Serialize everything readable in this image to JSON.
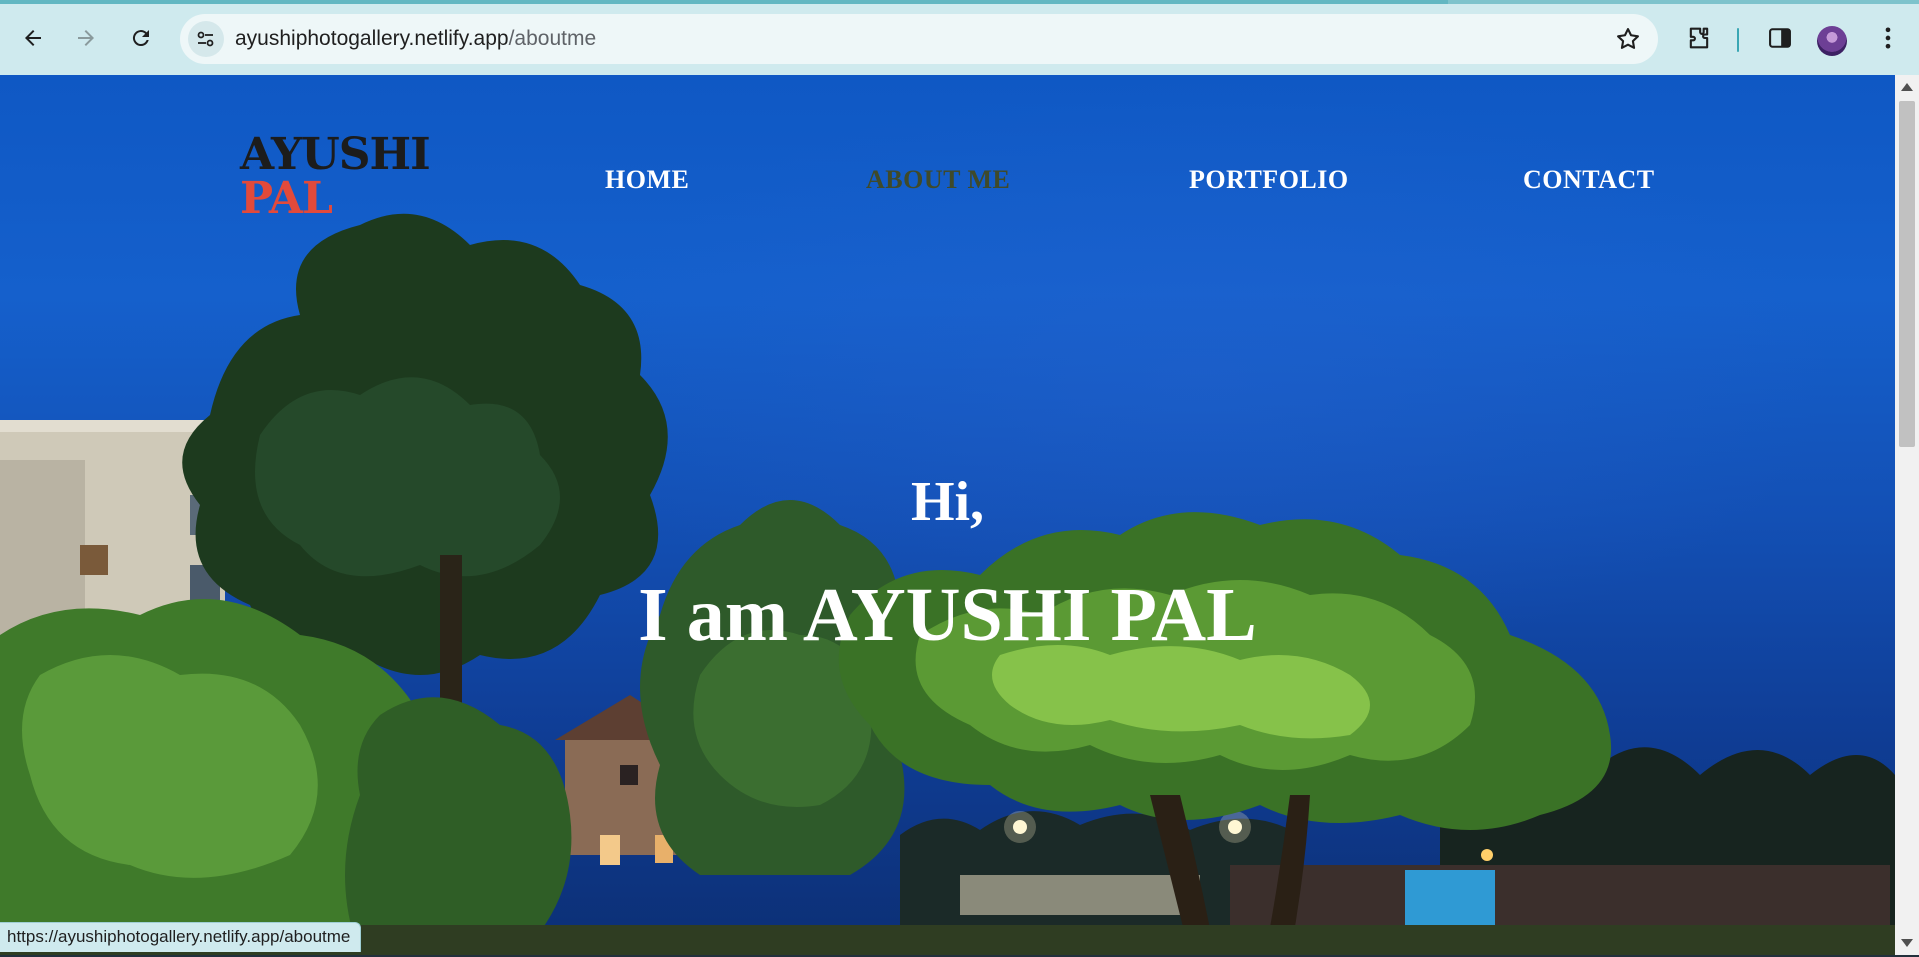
{
  "browser": {
    "url_host": "ayushiphotogallery.netlify.app",
    "url_path": "/aboutme",
    "status_url": "https://ayushiphotogallery.netlify.app/aboutme"
  },
  "site": {
    "logo_line1": "AYUSHI",
    "logo_line2": "PAL",
    "nav": [
      {
        "label": "HOME"
      },
      {
        "label": "ABOUT ME"
      },
      {
        "label": "PORTFOLIO"
      },
      {
        "label": "CONTACT"
      }
    ],
    "active_nav": "ABOUT ME",
    "greeting": "Hi,",
    "headline": "I am AYUSHI PAL"
  },
  "colors": {
    "logo_dark": "#1c1c1c",
    "logo_accent": "#e24a3b",
    "nav_text": "#ffffff",
    "nav_active": "#3f4a2a",
    "chrome_toolbar": "#cfeaee"
  },
  "icons": [
    "back-icon",
    "forward-icon",
    "reload-icon",
    "site-info-icon",
    "star-icon",
    "extensions-icon",
    "side-panel-icon",
    "profile-avatar",
    "kebab-menu-icon"
  ]
}
